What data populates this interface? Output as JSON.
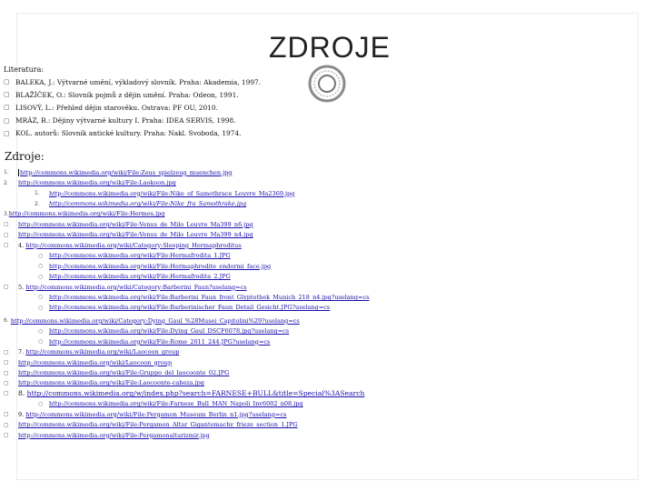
{
  "title": "ZDROJE",
  "literatura": {
    "label": "Literatura:",
    "items": [
      "BALEKA, J.: Výtvarné umění, výkladový slovník. Praha: Akademia, 1997.",
      "BLAŽÍČEK, O.: Slovník pojmů z dějin umění. Praha: Odeon, 1991.",
      "LISOVÝ, L.: Přehled dějin starověku. Ostrava: PF OU, 2010.",
      "MRÁZ, B.: Dějiny výtvarné kultury I. Praha: IDEA SERVIS, 1998.",
      "KOL. autorů: Slovník antické kultury. Praha: Nakl. Svoboda, 1974."
    ]
  },
  "zdroje": {
    "heading": "Zdroje:",
    "items": [
      {
        "marker": "1.",
        "text": "http://commons.wikimedia.org/wiki/File:Zeus_spielzeug_muenchen.jpg",
        "cursor": true
      },
      {
        "marker": "2.",
        "text": "http://commons.wikimedia.org/wiki/File:Laokoon.jpg"
      },
      {
        "marker": "1.",
        "text": "http://commons.wikimedia.org/wiki/File:Nike_of_Samothrace_Louvre_Ma2369.jpg"
      },
      {
        "marker": "2.",
        "text": "http://commons.wikimedia.org/wiki/File:Nike_fra_Samothrake.jpg",
        "italic": true
      },
      {
        "marker": "3.",
        "text": "http://commons.wikimedia.org/wiki/File:Hermes.jpg"
      },
      {
        "marker": "",
        "text": "http://commons.wikimedia.org/wiki/File:Venus_de_Milo_Louvre_Ma399_n6.jpg"
      },
      {
        "marker": "",
        "text": "http://commons.wikimedia.org/wiki/File:Venus_de_Milo_Louvre_Ma399_n4.jpg"
      },
      {
        "marker": "4.",
        "text": "http://commons.wikimedia.org/wiki/Category:Sleeping_Hermaphroditus"
      },
      {
        "marker": "",
        "text": "http://commons.wikimedia.org/wiki/File:Hermafrodita_1.JPG"
      },
      {
        "marker": "",
        "text": "http://commons.wikimedia.org/wiki/File:Hermaphrodite_endormi_face.jpg"
      },
      {
        "marker": "",
        "text": "http://commons.wikimedia.org/wiki/File:Hermafrodita_2.JPG"
      },
      {
        "marker": "5.",
        "text": "http://commons.wikimedia.org/wiki/Category:Barberini_Faun?uselang=cs"
      },
      {
        "marker": "",
        "text": "http://commons.wikimedia.org/wiki/File:Barberini_Faun_front_Glyptothek_Munich_218_n4.jpg?uselang=cs"
      },
      {
        "marker": "",
        "text": "http://commons.wikimedia.org/wiki/File:Barberinischer_Faun_Detail_Gesicht.JPG?uselang=cs"
      },
      {
        "marker": "6.",
        "text": "http://commons.wikimedia.org/wiki/Category:Dying_Gaul_%28Musei_Capitolini%29?uselang=cs"
      },
      {
        "marker": "",
        "text": "http://commons.wikimedia.org/wiki/File:Dying_Gaul_DSCF6078.jpg?uselang=cs"
      },
      {
        "marker": "",
        "text": "http://commons.wikimedia.org/wiki/File:Rome_2011_244.JPG?uselang=cs"
      },
      {
        "marker": "7.",
        "text": "http://commons.wikimedia.org/wiki/Laocoon_group"
      },
      {
        "marker": "",
        "text": "http://commons.wikimedia.org/wiki/Laocoon_group"
      },
      {
        "marker": "",
        "text": "http://commons.wikimedia.org/wiki/File:Gruppo_del_laocoonte_02.JPG"
      },
      {
        "marker": "",
        "text": "http://commons.wikimedia.org/wiki/File:Laocoonte-cabeza.jpg"
      },
      {
        "marker": "8.",
        "text": "http://commons.wikimedia.org/w/index.php?search=FARNESE+BULL&title=Special%3ASearch"
      },
      {
        "marker": "",
        "text": "http://commons.wikimedia.org/wiki/File:Farnese_Bull_MAN_Napoli_Inv6002_n08.jpg"
      },
      {
        "marker": "9.",
        "text": "http://commons.wikimedia.org/wiki/File:Pergamon_Museum_Berlin_n1.jpg?uselang=cs"
      },
      {
        "marker": "",
        "text": "http://commons.wikimedia.org/wiki/File:Pergamon_Altar_Gigantomachy_frieze_section_1.JPG"
      },
      {
        "marker": "",
        "text": "http://commons.wikimedia.org/wiki/File:Pergamonaltarizmir.jpg"
      }
    ]
  }
}
